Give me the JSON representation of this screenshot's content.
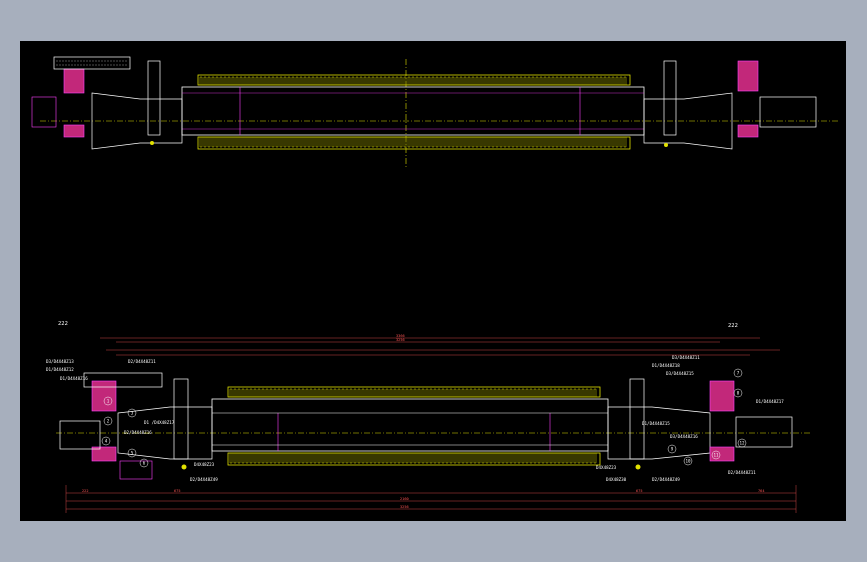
{
  "drawing": {
    "section_labels": [
      "222",
      "222"
    ],
    "part_labels_left": [
      "D3/D4X48Z13",
      "D1/D4X48Z12",
      "D1/D4X48Z16",
      "D2/D4X48Z11",
      "D1 /D4X48Z17",
      "D2/D4X48Z16",
      "D4X48Z23",
      "D2/D4X48Z49"
    ],
    "part_labels_right": [
      "D3/D4X48Z11",
      "D1/D4X48Z18",
      "D3/D4X48Z15",
      "D1/D4X48Z17",
      "D1/D4X48Z15",
      "D3/D4X48Z16",
      "D2/D4X48Z11",
      "D4X48Z23",
      "D4X48Z30",
      "D2/D4X48Z49"
    ],
    "balloons": [
      "1",
      "2",
      "3",
      "4",
      "5",
      "6",
      "7",
      "8",
      "9",
      "10",
      "11",
      "12"
    ],
    "dimensions": {
      "top_total": "3366",
      "top_inner": "3256",
      "left_a": "222",
      "left_b": "675",
      "right_a": "675",
      "right_b": "764",
      "bottom_main": "2160",
      "bottom_total": "3256"
    }
  },
  "colors": {
    "background": "#000000",
    "frame": "#a7afbd",
    "roller_teeth": "#e2e200",
    "centerline": "#e2e200",
    "magenta": "#ff40ff",
    "dimension": "#ff5555",
    "outline": "#ffffff",
    "hub": "#c2287a"
  }
}
